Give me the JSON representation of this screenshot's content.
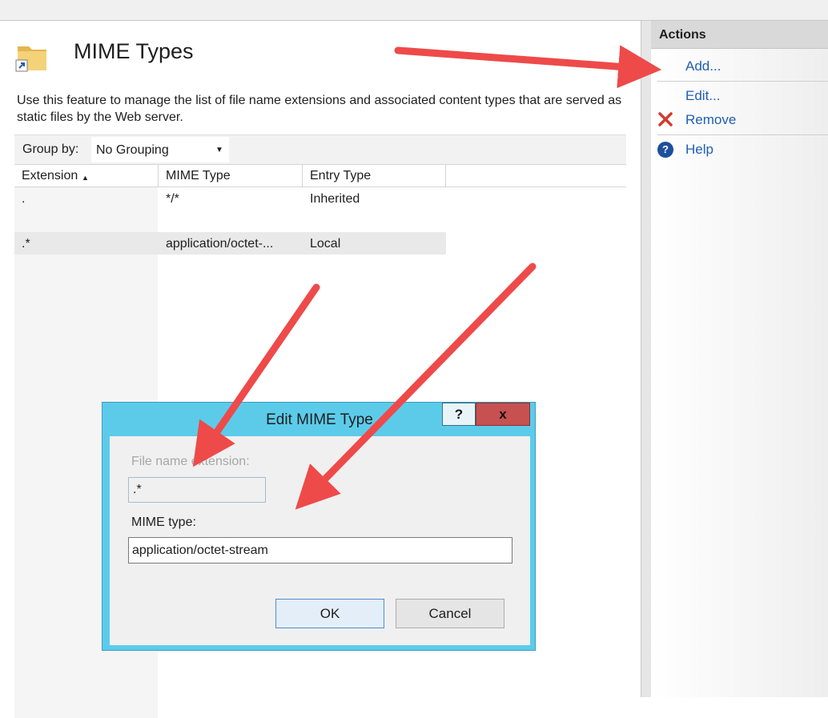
{
  "page": {
    "title": "MIME Types",
    "description": "Use this feature to manage the list of file name extensions and associated content types that are served as static files by the Web server."
  },
  "toolbar": {
    "group_by_label": "Group by:",
    "group_by_value": "No Grouping"
  },
  "grid": {
    "columns": [
      "Extension",
      "MIME Type",
      "Entry Type"
    ],
    "sort_column": "Extension",
    "rows": [
      {
        "extension": ".",
        "mime_type": "*/*",
        "entry_type": "Inherited"
      },
      {
        "extension": ".*",
        "mime_type": "application/octet-...",
        "entry_type": "Local"
      }
    ]
  },
  "actions": {
    "title": "Actions",
    "add": "Add...",
    "edit": "Edit...",
    "remove": "Remove",
    "help": "Help"
  },
  "dialog": {
    "title": "Edit MIME Type",
    "help_glyph": "?",
    "close_glyph": "x",
    "extension_label": "File name extension:",
    "extension_value": ".*",
    "mime_label": "MIME type:",
    "mime_value": "application/octet-stream",
    "ok": "OK",
    "cancel": "Cancel"
  },
  "colors": {
    "dialog_frame": "#5ccbea",
    "close_button": "#c75050",
    "link": "#1f5fb1",
    "annotation_arrow": "#ee4a4a"
  },
  "icons": [
    "folder-shortcut-icon",
    "dropdown-arrow-icon",
    "sort-ascending-icon",
    "remove-x-icon",
    "help-icon"
  ]
}
